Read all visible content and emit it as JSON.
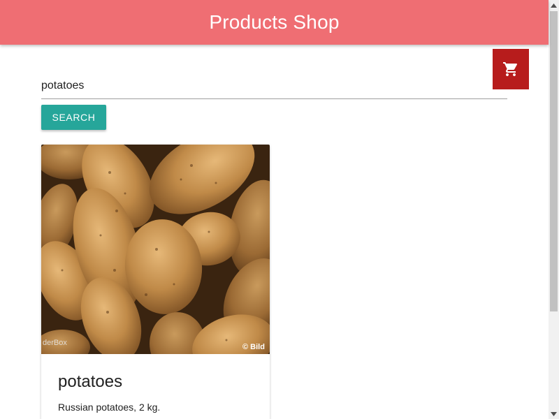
{
  "header": {
    "title": "Products Shop",
    "background_color": "#ef6e73"
  },
  "cart": {
    "icon": "shopping-cart-icon",
    "background_color": "#b71c1c"
  },
  "search": {
    "value": "potatoes",
    "button_label": "SEARCH",
    "button_color": "#26a69a"
  },
  "products": [
    {
      "title": "potatoes",
      "description": "Russian potatoes, 2 kg.",
      "image": "potatoes-photo",
      "image_watermark_left": "derBox",
      "image_watermark_right": "© Bild"
    }
  ]
}
